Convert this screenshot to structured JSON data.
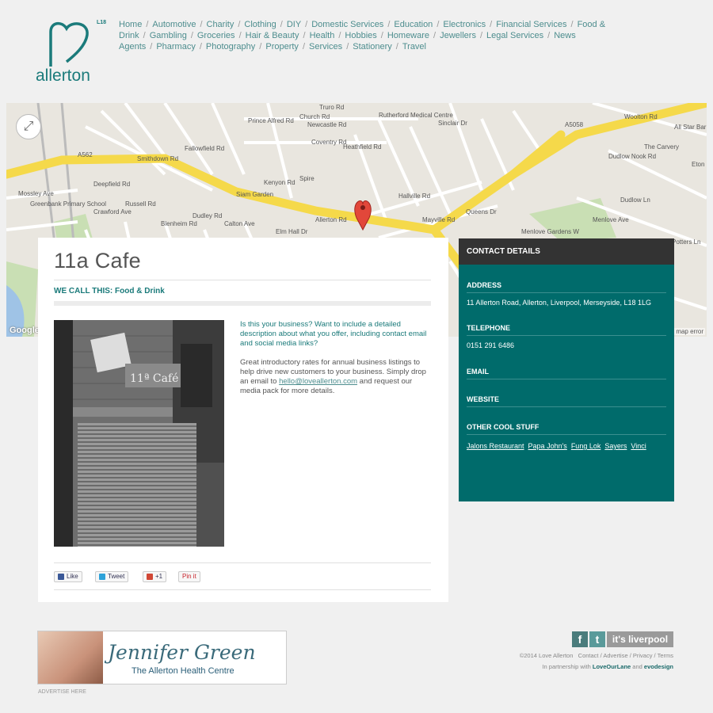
{
  "logo": {
    "text": "allerton",
    "superscript": "L18"
  },
  "nav": {
    "items": [
      "Home",
      "Automotive",
      "Charity",
      "Clothing",
      "DIY",
      "Domestic Services",
      "Education",
      "Electronics",
      "Financial Services",
      "Food & Drink",
      "Gambling",
      "Groceries",
      "Hair & Beauty",
      "Health",
      "Hobbies",
      "Homeware",
      "Jewellers",
      "Legal Services",
      "News Agents",
      "Pharmacy",
      "Photography",
      "Property",
      "Services",
      "Stationery",
      "Travel"
    ]
  },
  "map": {
    "labels": [
      "Truro Rd",
      "Rutherford Medical Centre",
      "Newcastle Rd",
      "Coventry Rd",
      "Church Rd",
      "Prince Alfred Rd",
      "Heathfield Rd",
      "Sinclair Dr",
      "Woolton Rd",
      "All Star Barber Shop",
      "The Carvery",
      "Eton Pla",
      "Dudlow Nook Rd",
      "Dudlow Ln",
      "A5058",
      "A562",
      "Smithdown Rd",
      "Deepfield Rd",
      "Fallowfield Rd",
      "Siam Garden",
      "Kenyon Rd",
      "Spire",
      "Allerton Rd",
      "Queens Dr",
      "Mayville Rd",
      "Hallville Rd",
      "Greenbank Primary School",
      "Mossley Ave",
      "Crawford Ave",
      "Russell Rd",
      "Calton Ave",
      "Elm Hall Dr",
      "Menlove Gardens W",
      "Menlove Ave",
      "Potters Ln",
      "Blenheim Rd",
      "Dudley Rd"
    ],
    "attribution": "Google",
    "error_text": "rt a map error"
  },
  "business": {
    "name": "11a Cafe",
    "category_label": "WE CALL THIS:",
    "category": "Food & Drink",
    "photo_sign": "11ª Café",
    "question": "Is this your business? Want to include a detailed description about what you offer, including contact email and social media links?",
    "body_before": "Great introductory rates for annual business listings to help drive new customers to your business. Simply drop an email to",
    "email": "hello@loveallerton.com",
    "body_after": "and request our media pack for more details."
  },
  "social_buttons": {
    "like": "Like",
    "tweet": "Tweet",
    "plus": "+1",
    "pin": "Pin it"
  },
  "contact": {
    "heading": "CONTACT DETAILS",
    "address_label": "ADDRESS",
    "address": "11 Allerton Road, Allerton, Liverpool, Merseyside, L18 1LG",
    "telephone_label": "TELEPHONE",
    "telephone": "0151 291 6486",
    "email_label": "EMAIL",
    "website_label": "WEBSITE",
    "other_label": "OTHER COOL STUFF",
    "other_links": [
      "Jalons Restaurant",
      "Papa John's",
      "Fung Lok",
      "Sayers",
      "Vinci"
    ]
  },
  "footer": {
    "ad_name": "Jennifer Green",
    "ad_sub": "The Allerton Health Centre",
    "advertise": "ADVERTISE HERE",
    "facebook": "f",
    "twitter": "t",
    "its_liverpool": "it's liverpool",
    "copyright": "©2014 Love Allerton",
    "links": "Contact / Advertise / Privacy / Terms",
    "partner_prefix": "In partnership with",
    "partner1": "LoveOurLane",
    "partner_and": "and",
    "partner2": "evodesign"
  },
  "colors": {
    "teal": "#006b6b",
    "dark": "#333333",
    "road": "#f5d94a",
    "map_bg": "#e9e6df"
  }
}
